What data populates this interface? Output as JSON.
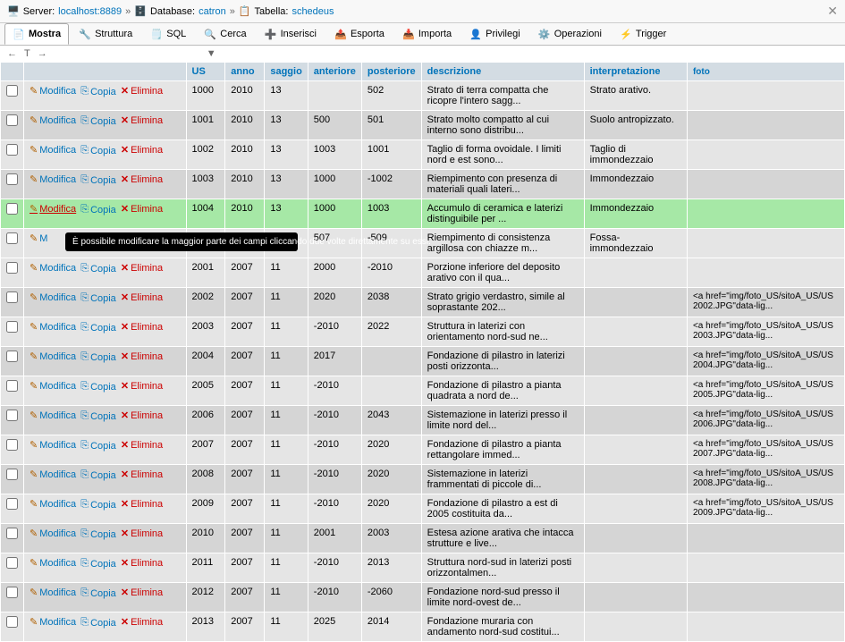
{
  "breadcrumb": {
    "server_lbl": "Server:",
    "server_val": "localhost:8889",
    "db_lbl": "Database:",
    "db_val": "catron",
    "table_lbl": "Tabella:",
    "table_val": "schedeus"
  },
  "tabs": [
    {
      "label": "Mostra",
      "active": true
    },
    {
      "label": "Struttura"
    },
    {
      "label": "SQL"
    },
    {
      "label": "Cerca"
    },
    {
      "label": "Inserisci"
    },
    {
      "label": "Esporta"
    },
    {
      "label": "Importa"
    },
    {
      "label": "Privilegi"
    },
    {
      "label": "Operazioni"
    },
    {
      "label": "Trigger"
    }
  ],
  "toolbar": {
    "arrow_left": "←",
    "t_symbol": "T",
    "arrow_right": "→",
    "sort_arrow": "▼"
  },
  "headers": {
    "us": "US",
    "anno": "anno",
    "saggio": "saggio",
    "anteriore": "anteriore",
    "posteriore": "posteriore",
    "descrizione": "descrizione",
    "interpretazione": "interpretazione",
    "foto": "foto"
  },
  "actions": {
    "edit": "Modifica",
    "copy": "Copia",
    "delete": "Elimina"
  },
  "tooltip": "È possibile modificare la maggior parte dei campi cliccando due volte direttamente su essi.",
  "rows": [
    {
      "us": "1000",
      "anno": "2010",
      "saggio": "13",
      "ant": "",
      "post": "502",
      "desc": "Strato di terra compatta che ricopre l'intero sagg...",
      "interp": "Strato arativo.",
      "foto": "",
      "cls": "odd"
    },
    {
      "us": "1001",
      "anno": "2010",
      "saggio": "13",
      "ant": "500",
      "post": "501",
      "desc": "Strato molto compatto al cui interno sono distribu...",
      "interp": "Suolo antropizzato.",
      "foto": "",
      "cls": "even"
    },
    {
      "us": "1002",
      "anno": "2010",
      "saggio": "13",
      "ant": "1003",
      "post": "1001",
      "desc": "Taglio di forma ovoidale. I limiti nord e est sono...",
      "interp": "Taglio di immondezzaio",
      "foto": "",
      "cls": "odd"
    },
    {
      "us": "1003",
      "anno": "2010",
      "saggio": "13",
      "ant": "1000",
      "post": "-1002",
      "desc": "Riempimento con presenza di materiali quali lateri...",
      "interp": "Immondezzaio",
      "foto": "",
      "cls": "even"
    },
    {
      "us": "1004",
      "anno": "2010",
      "saggio": "13",
      "ant": "1000",
      "post": "1003",
      "desc": "Accumulo di ceramica e laterizi distinguibile per ...",
      "interp": "Immondezzaio",
      "foto": "",
      "cls": "highlight"
    },
    {
      "us": "",
      "anno": "",
      "saggio": "",
      "ant": "507",
      "post": "-509",
      "desc": "Riempimento di consistenza argillosa con chiazze m...",
      "interp": "Fossa-immondezzaio",
      "foto": "",
      "cls": "tooltip-row"
    },
    {
      "us": "2001",
      "anno": "2007",
      "saggio": "11",
      "ant": "2000",
      "post": "-2010",
      "desc": "Porzione inferiore del deposito arativo con il qua...",
      "interp": "",
      "foto": "",
      "cls": "odd"
    },
    {
      "us": "2002",
      "anno": "2007",
      "saggio": "11",
      "ant": "2020",
      "post": "2038",
      "desc": "Strato grigio verdastro, simile al soprastante 202...",
      "interp": "",
      "foto": "<a href=\"img/foto_US/sitoA_US/US 2002.JPG\"data-lig...",
      "cls": "even"
    },
    {
      "us": "2003",
      "anno": "2007",
      "saggio": "11",
      "ant": "-2010",
      "post": "2022",
      "desc": "Struttura in laterizi con orientamento nord-sud ne...",
      "interp": "",
      "foto": "<a href=\"img/foto_US/sitoA_US/US 2003.JPG\"data-lig...",
      "cls": "odd"
    },
    {
      "us": "2004",
      "anno": "2007",
      "saggio": "11",
      "ant": "2017",
      "post": "",
      "desc": "Fondazione di pilastro in laterizi posti orizzonta...",
      "interp": "",
      "foto": "<a href=\"img/foto_US/sitoA_US/US 2004.JPG\"data-lig...",
      "cls": "even"
    },
    {
      "us": "2005",
      "anno": "2007",
      "saggio": "11",
      "ant": "-2010",
      "post": "",
      "desc": "Fondazione di pilastro a pianta quadrata a nord de...",
      "interp": "",
      "foto": "<a href=\"img/foto_US/sitoA_US/US 2005.JPG\"data-lig...",
      "cls": "odd"
    },
    {
      "us": "2006",
      "anno": "2007",
      "saggio": "11",
      "ant": "-2010",
      "post": "2043",
      "desc": "Sistemazione in laterizi presso il limite nord del...",
      "interp": "",
      "foto": "<a href=\"img/foto_US/sitoA_US/US 2006.JPG\"data-lig...",
      "cls": "even"
    },
    {
      "us": "2007",
      "anno": "2007",
      "saggio": "11",
      "ant": "-2010",
      "post": "2020",
      "desc": "Fondazione di pilastro a pianta rettangolare immed...",
      "interp": "",
      "foto": "<a href=\"img/foto_US/sitoA_US/US 2007.JPG\"data-lig...",
      "cls": "odd"
    },
    {
      "us": "2008",
      "anno": "2007",
      "saggio": "11",
      "ant": "-2010",
      "post": "2020",
      "desc": "Sistemazione in laterizi frammentati di piccole di...",
      "interp": "",
      "foto": "<a href=\"img/foto_US/sitoA_US/US 2008.JPG\"data-lig...",
      "cls": "even"
    },
    {
      "us": "2009",
      "anno": "2007",
      "saggio": "11",
      "ant": "-2010",
      "post": "2020",
      "desc": "Fondazione di pilastro a est di 2005 costituita da...",
      "interp": "",
      "foto": "<a href=\"img/foto_US/sitoA_US/US 2009.JPG\"data-lig...",
      "cls": "odd"
    },
    {
      "us": "2010",
      "anno": "2007",
      "saggio": "11",
      "ant": "2001",
      "post": "2003",
      "desc": "Estesa azione arativa che intacca strutture e live...",
      "interp": "",
      "foto": "",
      "cls": "even"
    },
    {
      "us": "2011",
      "anno": "2007",
      "saggio": "11",
      "ant": "-2010",
      "post": "2013",
      "desc": "Struttura nord-sud in laterizi posti orizzontalmen...",
      "interp": "",
      "foto": "",
      "cls": "odd"
    },
    {
      "us": "2012",
      "anno": "2007",
      "saggio": "11",
      "ant": "-2010",
      "post": "-2060",
      "desc": "Fondazione nord-sud presso il limite nord-ovest de...",
      "interp": "",
      "foto": "",
      "cls": "even"
    },
    {
      "us": "2013",
      "anno": "2007",
      "saggio": "11",
      "ant": "2025",
      "post": "2014",
      "desc": "Fondazione muraria con andamento nord-sud costitui...",
      "interp": "",
      "foto": "",
      "cls": "odd"
    }
  ]
}
